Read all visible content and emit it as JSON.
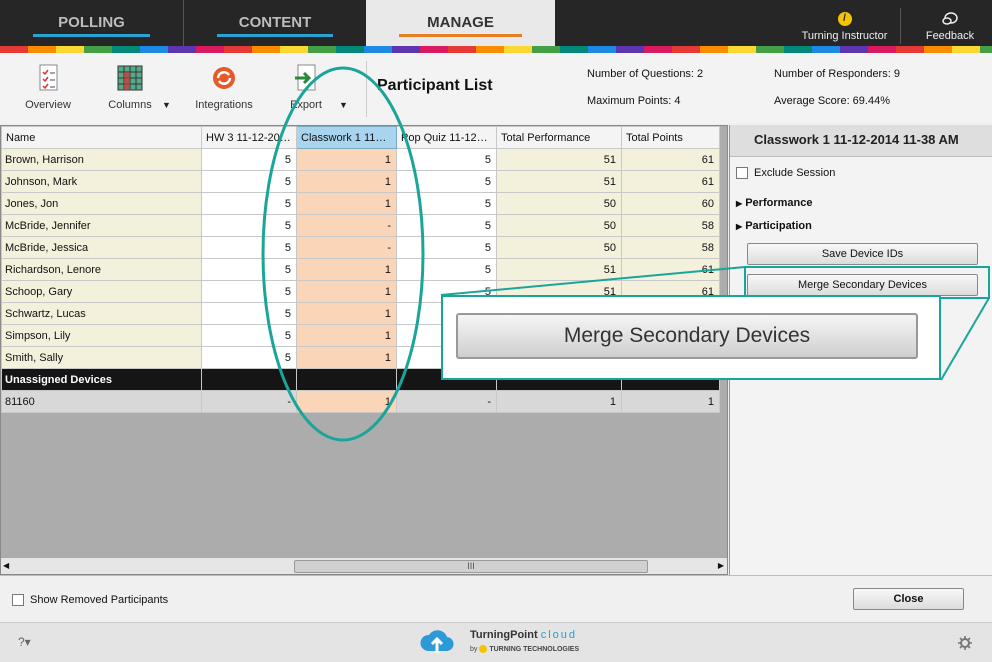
{
  "nav": {
    "tabs": [
      {
        "label": "POLLING",
        "color": "#29a3d6"
      },
      {
        "label": "CONTENT",
        "color": "#29a3d6"
      },
      {
        "label": "MANAGE",
        "color": "#e67e22"
      }
    ],
    "instructor_label": "Turning Instructor",
    "feedback_label": "Feedback"
  },
  "toolbar": {
    "overview": "Overview",
    "columns": "Columns",
    "integrations": "Integrations",
    "export": "Export",
    "title": "Participant List",
    "num_questions": "Number of Questions: 2",
    "max_points": "Maximum Points: 4",
    "num_responders": "Number of Responders: 9",
    "avg_score": "Average Score: 69.44%"
  },
  "table": {
    "headers": [
      "Name",
      "HW 3 11-12-20…",
      "Classwork 1 11…",
      "Pop Quiz 11-12…",
      "Total Performance",
      "Total Points"
    ],
    "rows": [
      {
        "name": "Brown, Harrison",
        "c1": "5",
        "c2": "1",
        "c3": "5",
        "c4": "51",
        "c5": "61"
      },
      {
        "name": "Johnson, Mark",
        "c1": "5",
        "c2": "1",
        "c3": "5",
        "c4": "51",
        "c5": "61"
      },
      {
        "name": "Jones, Jon",
        "c1": "5",
        "c2": "1",
        "c3": "5",
        "c4": "50",
        "c5": "60"
      },
      {
        "name": "McBride, Jennifer",
        "c1": "5",
        "c2": "-",
        "c3": "5",
        "c4": "50",
        "c5": "58"
      },
      {
        "name": "McBride, Jessica",
        "c1": "5",
        "c2": "-",
        "c3": "5",
        "c4": "50",
        "c5": "58"
      },
      {
        "name": "Richardson, Lenore",
        "c1": "5",
        "c2": "1",
        "c3": "5",
        "c4": "51",
        "c5": "61"
      },
      {
        "name": "Schoop, Gary",
        "c1": "5",
        "c2": "1",
        "c3": "5",
        "c4": "51",
        "c5": "61"
      },
      {
        "name": "Schwartz, Lucas",
        "c1": "5",
        "c2": "1",
        "c3": "",
        "c4": "",
        "c5": ""
      },
      {
        "name": "Simpson, Lily",
        "c1": "5",
        "c2": "1",
        "c3": "",
        "c4": "",
        "c5": ""
      },
      {
        "name": "Smith, Sally",
        "c1": "5",
        "c2": "1",
        "c3": "",
        "c4": "",
        "c5": ""
      }
    ],
    "unassigned_label": "Unassigned Devices",
    "device": {
      "name": "81160",
      "c1": "-",
      "c2": "1",
      "c3": "-",
      "c4": "1",
      "c5": "1"
    }
  },
  "panel": {
    "title": "Classwork 1 11-12-2014 11-38 AM",
    "exclude": "Exclude Session",
    "performance": "Performance",
    "participation": "Participation",
    "save_ids": "Save Device IDs",
    "merge": "Merge Secondary Devices"
  },
  "callout_label": "Merge Secondary Devices",
  "scroll_thumb": "III",
  "bottom": {
    "show_removed": "Show Removed Participants",
    "close": "Close"
  },
  "footer": {
    "brand": "TurningPoint",
    "brand2": "cloud",
    "by": "by",
    "company": "TURNING TECHNOLOGIES"
  }
}
